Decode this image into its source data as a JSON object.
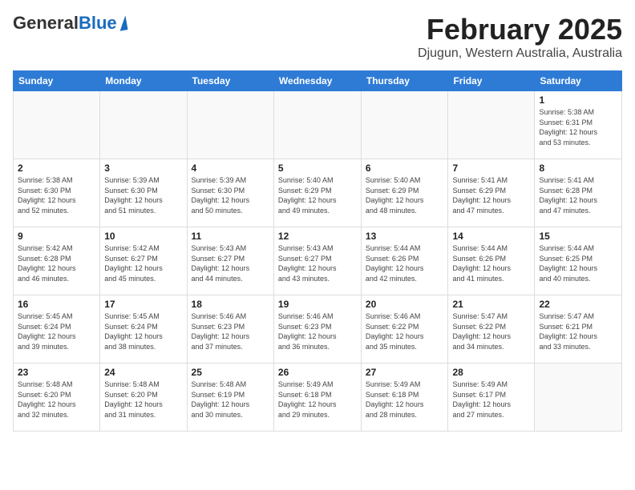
{
  "logo": {
    "general": "General",
    "blue": "Blue"
  },
  "header": {
    "month": "February 2025",
    "location": "Djugun, Western Australia, Australia"
  },
  "days_of_week": [
    "Sunday",
    "Monday",
    "Tuesday",
    "Wednesday",
    "Thursday",
    "Friday",
    "Saturday"
  ],
  "weeks": [
    [
      {
        "day": "",
        "info": ""
      },
      {
        "day": "",
        "info": ""
      },
      {
        "day": "",
        "info": ""
      },
      {
        "day": "",
        "info": ""
      },
      {
        "day": "",
        "info": ""
      },
      {
        "day": "",
        "info": ""
      },
      {
        "day": "1",
        "info": "Sunrise: 5:38 AM\nSunset: 6:31 PM\nDaylight: 12 hours\nand 53 minutes."
      }
    ],
    [
      {
        "day": "2",
        "info": "Sunrise: 5:38 AM\nSunset: 6:30 PM\nDaylight: 12 hours\nand 52 minutes."
      },
      {
        "day": "3",
        "info": "Sunrise: 5:39 AM\nSunset: 6:30 PM\nDaylight: 12 hours\nand 51 minutes."
      },
      {
        "day": "4",
        "info": "Sunrise: 5:39 AM\nSunset: 6:30 PM\nDaylight: 12 hours\nand 50 minutes."
      },
      {
        "day": "5",
        "info": "Sunrise: 5:40 AM\nSunset: 6:29 PM\nDaylight: 12 hours\nand 49 minutes."
      },
      {
        "day": "6",
        "info": "Sunrise: 5:40 AM\nSunset: 6:29 PM\nDaylight: 12 hours\nand 48 minutes."
      },
      {
        "day": "7",
        "info": "Sunrise: 5:41 AM\nSunset: 6:29 PM\nDaylight: 12 hours\nand 47 minutes."
      },
      {
        "day": "8",
        "info": "Sunrise: 5:41 AM\nSunset: 6:28 PM\nDaylight: 12 hours\nand 47 minutes."
      }
    ],
    [
      {
        "day": "9",
        "info": "Sunrise: 5:42 AM\nSunset: 6:28 PM\nDaylight: 12 hours\nand 46 minutes."
      },
      {
        "day": "10",
        "info": "Sunrise: 5:42 AM\nSunset: 6:27 PM\nDaylight: 12 hours\nand 45 minutes."
      },
      {
        "day": "11",
        "info": "Sunrise: 5:43 AM\nSunset: 6:27 PM\nDaylight: 12 hours\nand 44 minutes."
      },
      {
        "day": "12",
        "info": "Sunrise: 5:43 AM\nSunset: 6:27 PM\nDaylight: 12 hours\nand 43 minutes."
      },
      {
        "day": "13",
        "info": "Sunrise: 5:44 AM\nSunset: 6:26 PM\nDaylight: 12 hours\nand 42 minutes."
      },
      {
        "day": "14",
        "info": "Sunrise: 5:44 AM\nSunset: 6:26 PM\nDaylight: 12 hours\nand 41 minutes."
      },
      {
        "day": "15",
        "info": "Sunrise: 5:44 AM\nSunset: 6:25 PM\nDaylight: 12 hours\nand 40 minutes."
      }
    ],
    [
      {
        "day": "16",
        "info": "Sunrise: 5:45 AM\nSunset: 6:24 PM\nDaylight: 12 hours\nand 39 minutes."
      },
      {
        "day": "17",
        "info": "Sunrise: 5:45 AM\nSunset: 6:24 PM\nDaylight: 12 hours\nand 38 minutes."
      },
      {
        "day": "18",
        "info": "Sunrise: 5:46 AM\nSunset: 6:23 PM\nDaylight: 12 hours\nand 37 minutes."
      },
      {
        "day": "19",
        "info": "Sunrise: 5:46 AM\nSunset: 6:23 PM\nDaylight: 12 hours\nand 36 minutes."
      },
      {
        "day": "20",
        "info": "Sunrise: 5:46 AM\nSunset: 6:22 PM\nDaylight: 12 hours\nand 35 minutes."
      },
      {
        "day": "21",
        "info": "Sunrise: 5:47 AM\nSunset: 6:22 PM\nDaylight: 12 hours\nand 34 minutes."
      },
      {
        "day": "22",
        "info": "Sunrise: 5:47 AM\nSunset: 6:21 PM\nDaylight: 12 hours\nand 33 minutes."
      }
    ],
    [
      {
        "day": "23",
        "info": "Sunrise: 5:48 AM\nSunset: 6:20 PM\nDaylight: 12 hours\nand 32 minutes."
      },
      {
        "day": "24",
        "info": "Sunrise: 5:48 AM\nSunset: 6:20 PM\nDaylight: 12 hours\nand 31 minutes."
      },
      {
        "day": "25",
        "info": "Sunrise: 5:48 AM\nSunset: 6:19 PM\nDaylight: 12 hours\nand 30 minutes."
      },
      {
        "day": "26",
        "info": "Sunrise: 5:49 AM\nSunset: 6:18 PM\nDaylight: 12 hours\nand 29 minutes."
      },
      {
        "day": "27",
        "info": "Sunrise: 5:49 AM\nSunset: 6:18 PM\nDaylight: 12 hours\nand 28 minutes."
      },
      {
        "day": "28",
        "info": "Sunrise: 5:49 AM\nSunset: 6:17 PM\nDaylight: 12 hours\nand 27 minutes."
      },
      {
        "day": "",
        "info": ""
      }
    ]
  ]
}
